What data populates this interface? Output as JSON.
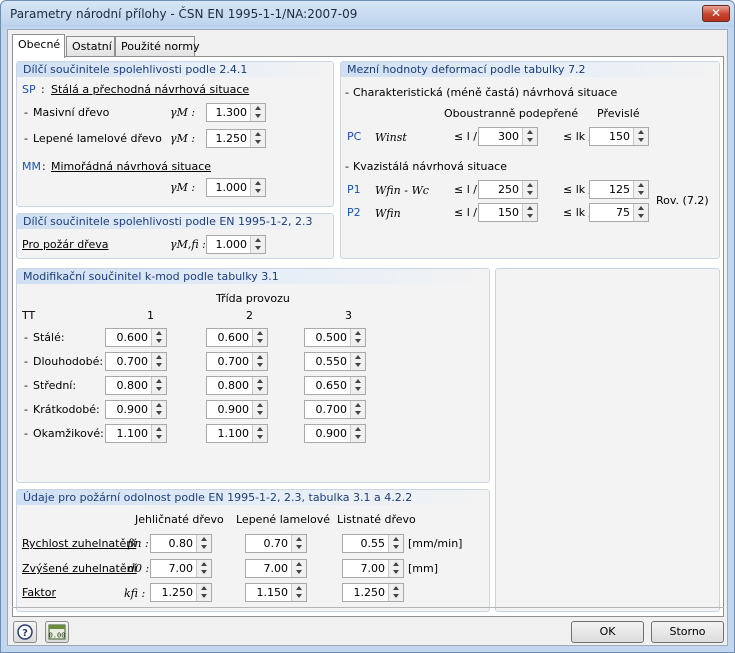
{
  "window": {
    "title": "Parametry národní přílohy - ČSN EN 1995-1-1/NA:2007-09",
    "close": "✕"
  },
  "tabs": [
    "Obecné",
    "Ostatní",
    "Použité normy"
  ],
  "partial": {
    "title": "Dílčí součinitele spolehlivosti podle 2.4.1",
    "sp_code": "SP",
    "sp_colon": ":",
    "sp_label": "Stálá a přechodná návrhová situace",
    "rows": [
      {
        "label": "Masivní dřevo",
        "sym": "γM :",
        "value": "1.300"
      },
      {
        "label": "Lepené lamelové dřevo",
        "sym": "γM :",
        "value": "1.250"
      }
    ],
    "mm_code": "MM",
    "mm_colon": ":",
    "mm_label": "Mimořádná návrhová situace",
    "mm_sym": "γM :",
    "mm_value": "1.000"
  },
  "fire_partial": {
    "title": "Dílčí součinitele spolehlivosti podle EN 1995-1-2, 2.3",
    "label": "Pro požár dřeva",
    "sym": "γM,fi :",
    "value": "1.000"
  },
  "deform": {
    "title": "Mezní hodnoty deformací podle tabulky 7.2",
    "char_label": "Charakteristická (méně častá) návrhová situace",
    "col_both": "Oboustranně podepřené",
    "col_cant": "Převislé",
    "pc": {
      "code": "PC",
      "sym": "Winst",
      "rel1": "≤ l /",
      "v1": "300",
      "rel2": "≤ lk /",
      "v2": "150"
    },
    "quasi_label": "Kvazistálá návrhová situace",
    "p1": {
      "code": "P1",
      "sym": "Wfin - Wc",
      "rel1": "≤ l /",
      "v1": "250",
      "rel2": "≤ lk /",
      "v2": "125"
    },
    "p2": {
      "code": "P2",
      "sym": "Wfin",
      "rel1": "≤ l /",
      "v1": "150",
      "rel2": "≤ lk /",
      "v2": "75"
    },
    "rov": "Rov. (7.2)"
  },
  "kmod": {
    "title": "Modifikační součinitel k-mod podle tabulky 3.1",
    "class_label": "Třída provozu",
    "tt": "TT",
    "c1": "1",
    "c2": "2",
    "c3": "3",
    "rows": [
      {
        "label": "Stálé:",
        "v": [
          "0.600",
          "0.600",
          "0.500"
        ]
      },
      {
        "label": "Dlouhodobé:",
        "v": [
          "0.700",
          "0.700",
          "0.550"
        ]
      },
      {
        "label": "Střední:",
        "v": [
          "0.800",
          "0.800",
          "0.650"
        ]
      },
      {
        "label": "Krátkodobé:",
        "v": [
          "0.900",
          "0.900",
          "0.700"
        ]
      },
      {
        "label": "Okamžikové:",
        "v": [
          "1.100",
          "1.100",
          "0.900"
        ]
      }
    ]
  },
  "fire": {
    "title": "Údaje pro požární odolnost podle EN 1995-1-2, 2.3, tabulka 3.1 a 4.2.2",
    "c1": "Jehličnaté dřevo",
    "c2": "Lepené lamelové",
    "c3": "Listnaté dřevo",
    "rows": [
      {
        "label": "Rychlost zuhelnatění",
        "sym": "βn :",
        "v": [
          "0.80",
          "0.70",
          "0.55"
        ],
        "unit": "[mm/min]"
      },
      {
        "label": "Zvýšené zuhelnatění",
        "sym": "d0 :",
        "v": [
          "7.00",
          "7.00",
          "7.00"
        ],
        "unit": "[mm]"
      },
      {
        "label": "Faktor",
        "sym": "kfi :",
        "v": [
          "1.250",
          "1.150",
          "1.250"
        ],
        "unit": ""
      }
    ]
  },
  "buttons": {
    "ok": "OK",
    "cancel": "Storno"
  },
  "icons": {
    "help": "help-icon",
    "units": "units-icon",
    "units_text": "0.00"
  }
}
